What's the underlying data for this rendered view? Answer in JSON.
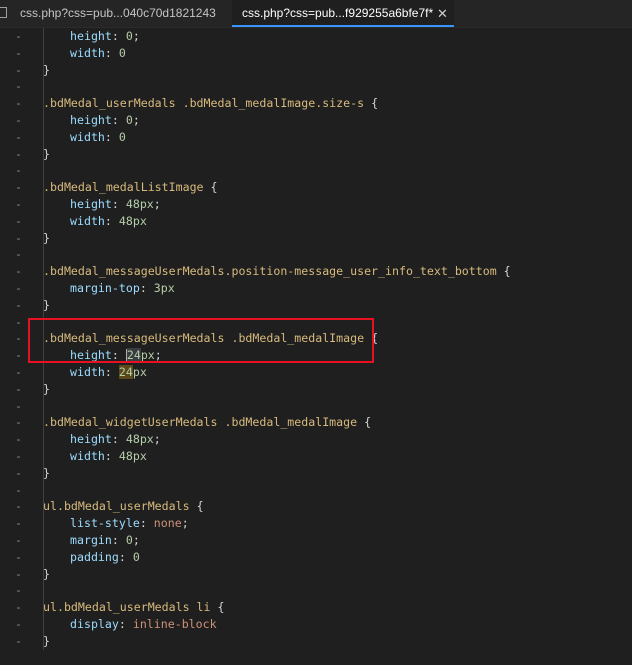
{
  "tabs": [
    {
      "label": "css.php?css=pub...040c70d1821243",
      "active": false
    },
    {
      "label": "css.php?css=pub...f929255a6bfe7f*",
      "active": true,
      "close": "✕"
    }
  ],
  "editor": {
    "gutter_marker": "-",
    "lines": [
      {
        "indent": 2,
        "tokens": [
          {
            "t": "prop",
            "v": "height"
          },
          {
            "t": "punc",
            "v": ": "
          },
          {
            "t": "num",
            "v": "0"
          },
          {
            "t": "punc",
            "v": ";"
          }
        ]
      },
      {
        "indent": 2,
        "tokens": [
          {
            "t": "prop",
            "v": "width"
          },
          {
            "t": "punc",
            "v": ": "
          },
          {
            "t": "num",
            "v": "0"
          }
        ]
      },
      {
        "indent": 1,
        "tokens": [
          {
            "t": "punc",
            "v": "}"
          }
        ]
      },
      {
        "indent": 0,
        "tokens": []
      },
      {
        "indent": 1,
        "tokens": [
          {
            "t": "sel",
            "v": ".bdMedal_userMedals .bdMedal_medalImage.size-s"
          },
          {
            "t": "punc",
            "v": " {"
          }
        ]
      },
      {
        "indent": 2,
        "tokens": [
          {
            "t": "prop",
            "v": "height"
          },
          {
            "t": "punc",
            "v": ": "
          },
          {
            "t": "num",
            "v": "0"
          },
          {
            "t": "punc",
            "v": ";"
          }
        ]
      },
      {
        "indent": 2,
        "tokens": [
          {
            "t": "prop",
            "v": "width"
          },
          {
            "t": "punc",
            "v": ": "
          },
          {
            "t": "num",
            "v": "0"
          }
        ]
      },
      {
        "indent": 1,
        "tokens": [
          {
            "t": "punc",
            "v": "}"
          }
        ]
      },
      {
        "indent": 0,
        "tokens": []
      },
      {
        "indent": 1,
        "tokens": [
          {
            "t": "sel",
            "v": ".bdMedal_medalListImage"
          },
          {
            "t": "punc",
            "v": " {"
          }
        ]
      },
      {
        "indent": 2,
        "tokens": [
          {
            "t": "prop",
            "v": "height"
          },
          {
            "t": "punc",
            "v": ": "
          },
          {
            "t": "num",
            "v": "48px"
          },
          {
            "t": "punc",
            "v": ";"
          }
        ]
      },
      {
        "indent": 2,
        "tokens": [
          {
            "t": "prop",
            "v": "width"
          },
          {
            "t": "punc",
            "v": ": "
          },
          {
            "t": "num",
            "v": "48px"
          }
        ]
      },
      {
        "indent": 1,
        "tokens": [
          {
            "t": "punc",
            "v": "}"
          }
        ]
      },
      {
        "indent": 0,
        "tokens": []
      },
      {
        "indent": 1,
        "tokens": [
          {
            "t": "sel",
            "v": ".bdMedal_messageUserMedals.position-message_user_info_text_bottom"
          },
          {
            "t": "punc",
            "v": " {"
          }
        ]
      },
      {
        "indent": 2,
        "tokens": [
          {
            "t": "prop",
            "v": "margin-top"
          },
          {
            "t": "punc",
            "v": ": "
          },
          {
            "t": "num",
            "v": "3px"
          }
        ]
      },
      {
        "indent": 1,
        "tokens": [
          {
            "t": "punc",
            "v": "}"
          }
        ]
      },
      {
        "indent": 0,
        "tokens": []
      },
      {
        "indent": 1,
        "tokens": [
          {
            "t": "sel",
            "v": ".bdMedal_messageUserMedals .bdMedal_medalImage"
          },
          {
            "t": "punc",
            "v": " {"
          }
        ]
      },
      {
        "indent": 2,
        "tokens": [
          {
            "t": "prop",
            "v": "height"
          },
          {
            "t": "punc",
            "v": ": "
          },
          {
            "t": "cursor",
            "v": ""
          },
          {
            "t": "numhl",
            "v": "24"
          },
          {
            "t": "num",
            "v": "px"
          },
          {
            "t": "punc",
            "v": ";"
          }
        ]
      },
      {
        "indent": 2,
        "tokens": [
          {
            "t": "prop",
            "v": "width"
          },
          {
            "t": "punc",
            "v": ": "
          },
          {
            "t": "numhl2",
            "v": "24"
          },
          {
            "t": "num",
            "v": "px"
          }
        ]
      },
      {
        "indent": 1,
        "tokens": [
          {
            "t": "punc",
            "v": "}"
          }
        ]
      },
      {
        "indent": 0,
        "tokens": []
      },
      {
        "indent": 1,
        "tokens": [
          {
            "t": "sel",
            "v": ".bdMedal_widgetUserMedals .bdMedal_medalImage"
          },
          {
            "t": "punc",
            "v": " {"
          }
        ]
      },
      {
        "indent": 2,
        "tokens": [
          {
            "t": "prop",
            "v": "height"
          },
          {
            "t": "punc",
            "v": ": "
          },
          {
            "t": "num",
            "v": "48px"
          },
          {
            "t": "punc",
            "v": ";"
          }
        ]
      },
      {
        "indent": 2,
        "tokens": [
          {
            "t": "prop",
            "v": "width"
          },
          {
            "t": "punc",
            "v": ": "
          },
          {
            "t": "num",
            "v": "48px"
          }
        ]
      },
      {
        "indent": 1,
        "tokens": [
          {
            "t": "punc",
            "v": "}"
          }
        ]
      },
      {
        "indent": 0,
        "tokens": []
      },
      {
        "indent": 1,
        "tokens": [
          {
            "t": "sel",
            "v": "ul.bdMedal_userMedals"
          },
          {
            "t": "punc",
            "v": " {"
          }
        ]
      },
      {
        "indent": 2,
        "tokens": [
          {
            "t": "prop",
            "v": "list-style"
          },
          {
            "t": "punc",
            "v": ": "
          },
          {
            "t": "val",
            "v": "none"
          },
          {
            "t": "punc",
            "v": ";"
          }
        ]
      },
      {
        "indent": 2,
        "tokens": [
          {
            "t": "prop",
            "v": "margin"
          },
          {
            "t": "punc",
            "v": ": "
          },
          {
            "t": "num",
            "v": "0"
          },
          {
            "t": "punc",
            "v": ";"
          }
        ]
      },
      {
        "indent": 2,
        "tokens": [
          {
            "t": "prop",
            "v": "padding"
          },
          {
            "t": "punc",
            "v": ": "
          },
          {
            "t": "num",
            "v": "0"
          }
        ]
      },
      {
        "indent": 1,
        "tokens": [
          {
            "t": "punc",
            "v": "}"
          }
        ]
      },
      {
        "indent": 0,
        "tokens": []
      },
      {
        "indent": 1,
        "tokens": [
          {
            "t": "sel",
            "v": "ul.bdMedal_userMedals li"
          },
          {
            "t": "punc",
            "v": " {"
          }
        ]
      },
      {
        "indent": 2,
        "tokens": [
          {
            "t": "prop",
            "v": "display"
          },
          {
            "t": "punc",
            "v": ": "
          },
          {
            "t": "val",
            "v": "inline-block"
          }
        ]
      },
      {
        "indent": 1,
        "tokens": [
          {
            "t": "punc",
            "v": "}"
          }
        ]
      }
    ]
  },
  "colors": {
    "selector": "#d7ba7d",
    "property": "#9cdcfe",
    "number": "#b5cea8",
    "value": "#ce9178",
    "highlight_box": "#e81123",
    "active_tab_underline": "#3794ff"
  }
}
